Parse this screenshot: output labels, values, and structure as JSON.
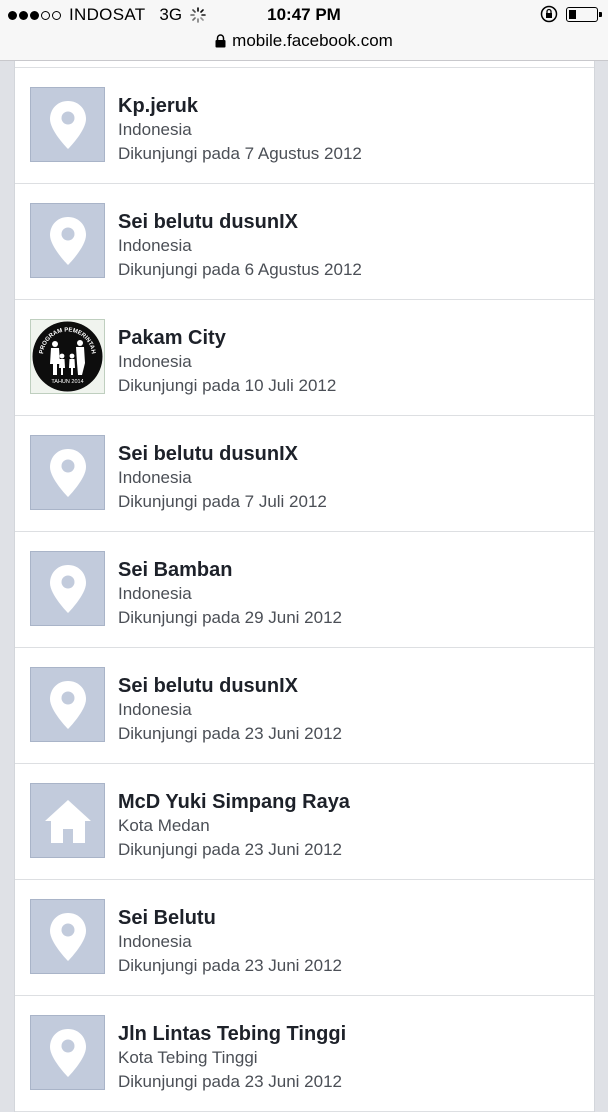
{
  "status_bar": {
    "carrier": "INDOSAT",
    "network": "3G",
    "time": "10:47 PM",
    "signal_bars_filled": 3,
    "signal_bars_total": 5
  },
  "url_bar": {
    "url": "mobile.facebook.com"
  },
  "places": [
    {
      "name": "Kp.jeruk",
      "location": "Indonesia",
      "visited": "Dikunjungi pada 7 Agustus 2012",
      "icon": "map-pin-icon"
    },
    {
      "name": "Sei belutu dusunIX",
      "location": "Indonesia",
      "visited": "Dikunjungi pada 6 Agustus 2012",
      "icon": "map-pin-icon"
    },
    {
      "name": "Pakam City",
      "location": "Indonesia",
      "visited": "Dikunjungi pada 10 Juli 2012",
      "icon": "place-photo",
      "photo_text_top": "PROGRAM PEMERINTAH",
      "photo_text_bottom": "TAHUN 2014"
    },
    {
      "name": "Sei belutu dusunIX",
      "location": "Indonesia",
      "visited": "Dikunjungi pada 7 Juli 2012",
      "icon": "map-pin-icon"
    },
    {
      "name": "Sei Bamban",
      "location": "Indonesia",
      "visited": "Dikunjungi pada 29 Juni 2012",
      "icon": "map-pin-icon"
    },
    {
      "name": "Sei belutu dusunIX",
      "location": "Indonesia",
      "visited": "Dikunjungi pada 23 Juni 2012",
      "icon": "map-pin-icon"
    },
    {
      "name": "McD Yuki Simpang Raya",
      "location": "Kota Medan",
      "visited": "Dikunjungi pada 23 Juni 2012",
      "icon": "house-icon"
    },
    {
      "name": "Sei Belutu",
      "location": "Indonesia",
      "visited": "Dikunjungi pada 23 Juni 2012",
      "icon": "map-pin-icon"
    },
    {
      "name": "Jln Lintas Tebing Tinggi",
      "location": "Kota Tebing Tinggi",
      "visited": "Dikunjungi pada 23 Juni 2012",
      "icon": "map-pin-icon"
    }
  ],
  "colors": {
    "thumb_bg": "#c2cbdc",
    "name_text": "#1d2129",
    "sub_text": "#4b4f56",
    "page_bg": "#dfe1e6"
  }
}
